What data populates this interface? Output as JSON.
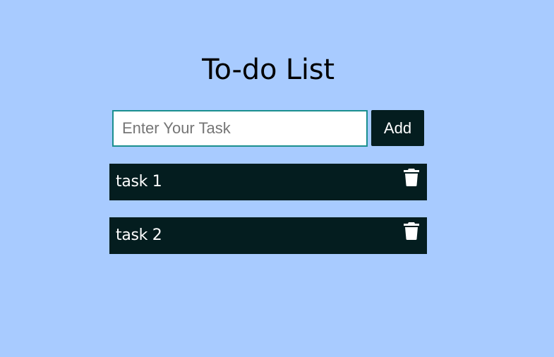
{
  "header": {
    "title": "To-do List"
  },
  "form": {
    "input_placeholder": "Enter Your Task",
    "input_value": "",
    "add_label": "Add"
  },
  "tasks": [
    {
      "label": "task 1",
      "icon": "trash-icon"
    },
    {
      "label": "task 2",
      "icon": "trash-icon"
    }
  ],
  "colors": {
    "background": "#a8cbff",
    "dark": "#041d1f",
    "input_border": "#1a8f8f"
  }
}
